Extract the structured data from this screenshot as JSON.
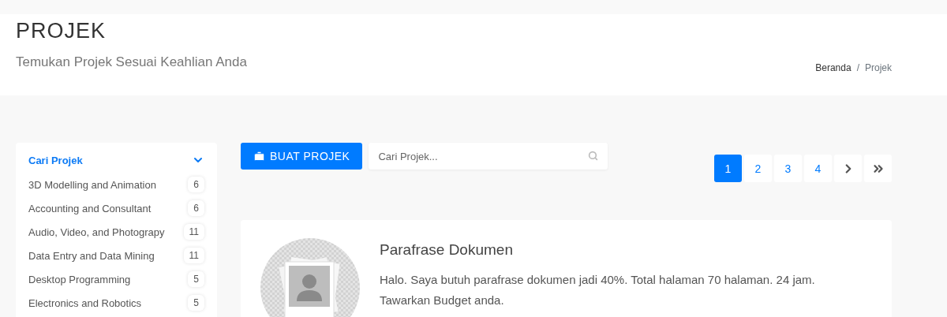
{
  "header": {
    "title": "PROJEK",
    "subtitle": "Temukan Projek Sesuai Keahlian Anda"
  },
  "breadcrumb": [
    {
      "label": "Beranda"
    },
    {
      "label": "Projek"
    }
  ],
  "breadcrumb_separator": "/",
  "sidebar": {
    "title": "Cari Projek",
    "expanded": true,
    "items": [
      {
        "label": "3D Modelling and Animation",
        "count": "6"
      },
      {
        "label": "Accounting and Consultant",
        "count": "6"
      },
      {
        "label": "Audio, Video, and Photograpy",
        "count": "11"
      },
      {
        "label": "Data Entry and Data Mining",
        "count": "11"
      },
      {
        "label": "Desktop Programming",
        "count": "5"
      },
      {
        "label": "Electronics and Robotics",
        "count": "5"
      }
    ]
  },
  "toolbar": {
    "create_button": "BUAT PROJEK",
    "search": {
      "placeholder": "Cari Projek..."
    }
  },
  "pagination": [
    {
      "kind": "page",
      "label": "1",
      "selected": true
    },
    {
      "kind": "page",
      "label": "2",
      "selected": false
    },
    {
      "kind": "page",
      "label": "3",
      "selected": false
    },
    {
      "kind": "page",
      "label": "4",
      "selected": false
    },
    {
      "kind": "next",
      "selected": false
    },
    {
      "kind": "last",
      "selected": false
    }
  ],
  "projects": [
    {
      "title": "Parafrase Dokumen",
      "description": "Halo. Saya butuh parafrase dokumen jadi 40%. Total halaman 70 halaman. 24 jam. Tawarkan Budget anda."
    }
  ]
}
